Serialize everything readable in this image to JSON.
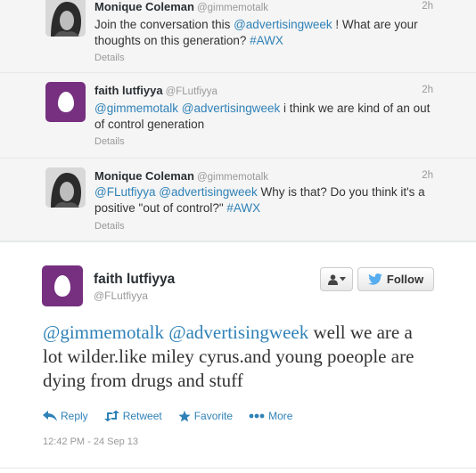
{
  "tweets": [
    {
      "name": "Monique Coleman",
      "handle": "@gimmemotalk",
      "time": "2h",
      "avatar": "photo",
      "parts": [
        {
          "text": "Join the conversation this ",
          "link": false
        },
        {
          "text": "@advertisingweek",
          "link": true
        },
        {
          "text": " ! What are your thoughts on this generation? ",
          "link": false
        },
        {
          "text": "#AWX",
          "link": true
        }
      ],
      "details": "Details"
    },
    {
      "name": "faith lutfiyya",
      "handle": "@FLutfiyya",
      "time": "2h",
      "avatar": "egg",
      "parts": [
        {
          "text": "@gimmemotalk",
          "link": true
        },
        {
          "text": " ",
          "link": false
        },
        {
          "text": "@advertisingweek",
          "link": true
        },
        {
          "text": " i think we are kind of an out of control generation",
          "link": false
        }
      ],
      "details": "Details"
    },
    {
      "name": "Monique Coleman",
      "handle": "@gimmemotalk",
      "time": "2h",
      "avatar": "photo",
      "parts": [
        {
          "text": "@FLutfiyya",
          "link": true
        },
        {
          "text": " ",
          "link": false
        },
        {
          "text": "@advertisingweek",
          "link": true
        },
        {
          "text": " Why is that? Do you think it's a positive \"out of control?\" ",
          "link": false
        },
        {
          "text": "#AWX",
          "link": true
        }
      ],
      "details": "Details"
    }
  ],
  "expanded": {
    "name": "faith lutfiyya",
    "handle": "@FLutfiyya",
    "follow_label": "Follow",
    "parts": [
      {
        "text": "@gimmemotalk",
        "link": true
      },
      {
        "text": " ",
        "link": false
      },
      {
        "text": "@advertisingweek",
        "link": true
      },
      {
        "text": " well we are a lot wilder.like miley cyrus.and young poeople are dying from drugs and stuff",
        "link": false
      }
    ],
    "actions": {
      "reply": "Reply",
      "retweet": "Retweet",
      "favorite": "Favorite",
      "more": "More"
    },
    "timestamp": "12:42 PM - 24 Sep 13"
  },
  "colors": {
    "link": "#2f81b7",
    "egg_bg": "#76307f",
    "twitter_blue": "#55acee"
  }
}
